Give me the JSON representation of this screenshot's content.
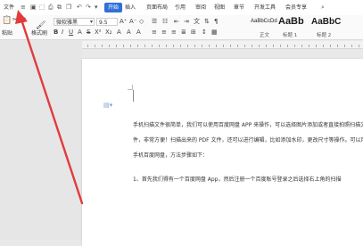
{
  "titlebar": {
    "file_menu": "文件",
    "tabs": [
      "开始",
      "插入",
      "页面布局",
      "引用",
      "审阅",
      "视图",
      "章节",
      "开发工具",
      "会员专享"
    ],
    "active_tab": "开始"
  },
  "ribbon": {
    "paste_label": "粘贴",
    "format_painter_label": "格式刷",
    "font_name": "微软雅黑",
    "font_size": "9.5",
    "styles": [
      {
        "preview": "AaBbCcDd",
        "caption": "正文"
      },
      {
        "preview": "AaBb",
        "caption": "标题 1"
      },
      {
        "preview": "AaBbC",
        "caption": "标题 2"
      }
    ]
  },
  "document": {
    "paragraphs": [
      "手机扫描文件很简单，我们可以使用百度网盘 APP 来操作，可以选择图片添加或者直接拍照扫描文",
      "件，非常方便！扫描出来的 PDF 文件，还可以进行编辑，比如添加水印，更改尺寸等操作。可以用",
      "手机百度网盘，方法步骤如下：",
      "1、首先我们得有一个百度网盘 App，然后注册一个百度账号登录之后选择右上角的扫描"
    ]
  },
  "colors": {
    "accent": "#2f6fd8",
    "arrow": "#e23b3b"
  }
}
